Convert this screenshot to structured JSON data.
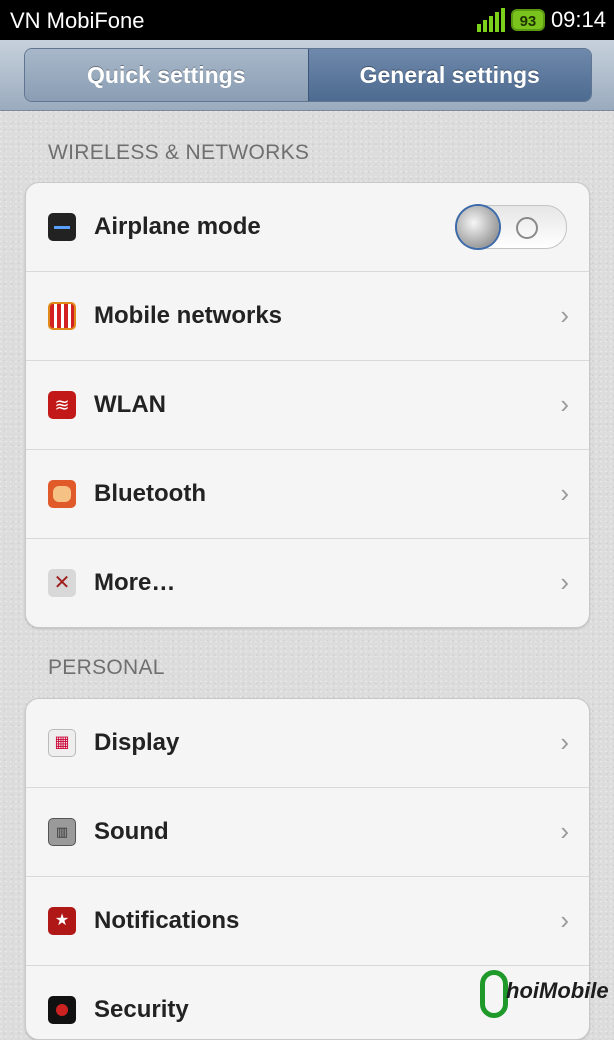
{
  "status_bar": {
    "carrier": "VN MobiFone",
    "battery_level": "93",
    "time": "09:14",
    "signal_color": "#7cd11a"
  },
  "tabs": [
    {
      "label": "Quick settings",
      "active": false
    },
    {
      "label": "General settings",
      "active": true
    }
  ],
  "sections": {
    "wireless": {
      "header": "WIRELESS & NETWORKS",
      "items": [
        {
          "label": "Airplane mode",
          "icon": "airplane-icon",
          "control": "toggle",
          "toggle_on": false
        },
        {
          "label": "Mobile networks",
          "icon": "mobile-networks-icon",
          "control": "chevron"
        },
        {
          "label": "WLAN",
          "icon": "wifi-icon",
          "control": "chevron"
        },
        {
          "label": "Bluetooth",
          "icon": "bluetooth-icon",
          "control": "chevron"
        },
        {
          "label": "More…",
          "icon": "tools-icon",
          "control": "chevron"
        }
      ]
    },
    "personal": {
      "header": "PERSONAL",
      "items": [
        {
          "label": "Display",
          "icon": "display-icon",
          "control": "chevron"
        },
        {
          "label": "Sound",
          "icon": "sound-icon",
          "control": "chevron"
        },
        {
          "label": "Notifications",
          "icon": "notifications-icon",
          "control": "chevron"
        },
        {
          "label": "Security",
          "icon": "security-icon",
          "control": "chevron"
        }
      ]
    }
  },
  "chevron_glyph": "›",
  "watermark": {
    "brand": "hoiMobile"
  },
  "colors": {
    "tab_active": "#4d6a90",
    "tab_inactive": "#8a9db3",
    "watermark_green": "#1f9a2a"
  }
}
